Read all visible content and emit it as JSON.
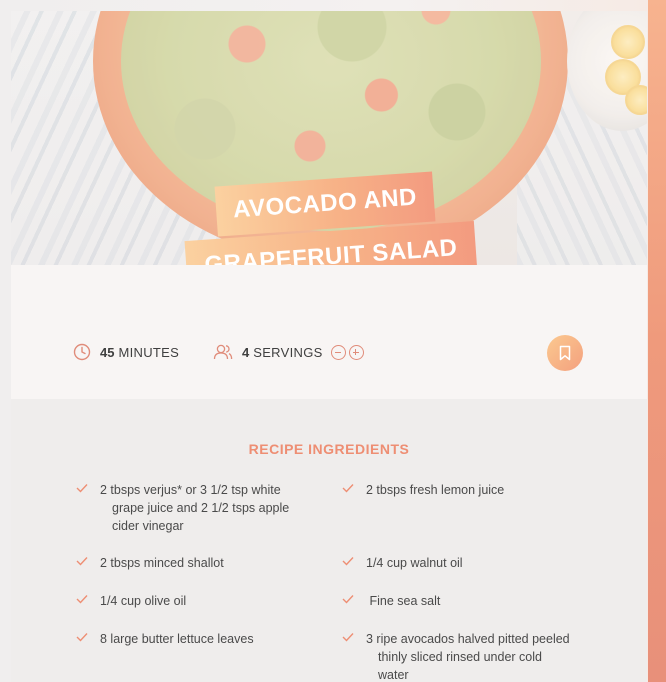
{
  "recipe": {
    "title_line_1": "AVOCADO AND",
    "title_line_2": "GRAPEFRUIT SALAD",
    "hero_image": "salad-bowl-photo"
  },
  "meta": {
    "time": {
      "value": "45",
      "unit": "MINUTES",
      "icon": "clock-icon"
    },
    "servings": {
      "value": "4",
      "unit": "SERVINGS",
      "icon": "users-icon"
    },
    "decrease_icon": "minus-circle-icon",
    "increase_icon": "plus-circle-icon",
    "bookmark_icon": "bookmark-icon"
  },
  "ingredients": {
    "heading": "RECIPE INGREDIENTS",
    "items": [
      {
        "line_1": "2 tbsps verjus* or 3 1/2 tsp white",
        "line_2": "grape juice and 2 1/2 tsps apple",
        "line_3": "cider vinegar"
      },
      {
        "line_1": "2 tbsps fresh lemon juice"
      },
      {
        "line_1": "2 tbsps minced shallot"
      },
      {
        "line_1": "1/4 cup walnut oil"
      },
      {
        "line_1": "1/4 cup olive oil"
      },
      {
        "line_1": " Fine sea salt"
      },
      {
        "line_1": "8 large butter lettuce leaves"
      },
      {
        "line_1": "3 ripe avocados halved pitted peeled",
        "line_2": "thinly sliced rinsed under cold",
        "line_3": "water"
      }
    ]
  },
  "colors": {
    "accent": "#ee8e73",
    "banner_start": "#fbd1a0",
    "banner_end": "#f39b80",
    "text": "#4a4a4a"
  }
}
